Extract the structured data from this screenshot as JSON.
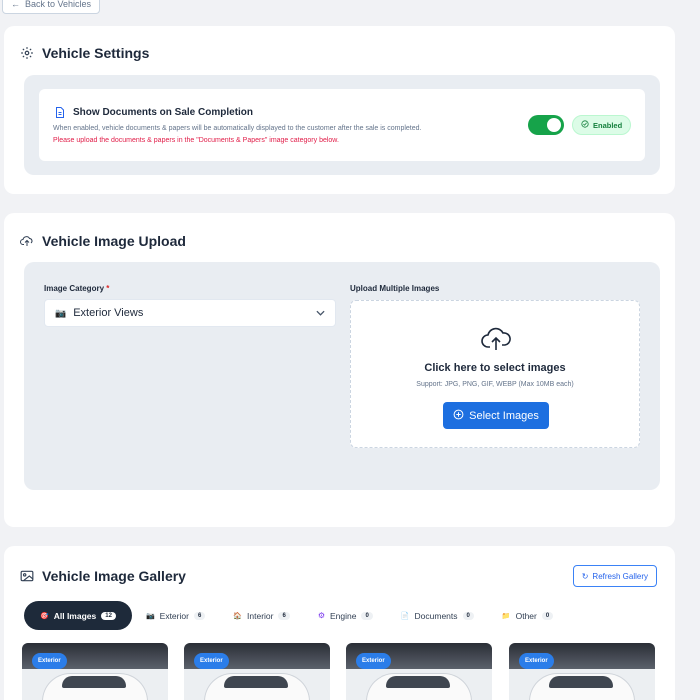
{
  "back_label": "Back to Vehicles",
  "settings": {
    "title": "Vehicle Settings",
    "doc_title": "Show Documents on Sale Completion",
    "doc_desc": "When enabled, vehicle documents & papers will be automatically displayed to the customer after the sale is completed.",
    "doc_warn": "Please upload the documents & papers in the \"Documents & Papers\" image category below.",
    "toggle_on": true,
    "enabled_label": "Enabled"
  },
  "upload": {
    "title": "Vehicle Image Upload",
    "category_label": "Image Category",
    "required_mark": "*",
    "category_value": "Exterior Views",
    "upload_label": "Upload Multiple Images",
    "dropzone_title": "Click here to select images",
    "dropzone_sub": "Support: JPG, PNG, GIF, WEBP (Max 10MB each)",
    "select_button": "Select Images"
  },
  "gallery": {
    "title": "Vehicle Image Gallery",
    "refresh_label": "Refresh Gallery",
    "tabs": [
      {
        "label": "All Images",
        "count": "12",
        "icon": "🎯"
      },
      {
        "label": "Exterior",
        "count": "6",
        "icon": "📷"
      },
      {
        "label": "Interior",
        "count": "6",
        "icon": "🏠"
      },
      {
        "label": "Engine",
        "count": "0",
        "icon": "⚙"
      },
      {
        "label": "Documents",
        "count": "0",
        "icon": "📄"
      },
      {
        "label": "Other",
        "count": "0",
        "icon": "📁"
      }
    ],
    "thumbs": [
      {
        "badge": "Exterior"
      },
      {
        "badge": "Exterior"
      },
      {
        "badge": "Exterior"
      },
      {
        "badge": "Exterior"
      }
    ]
  },
  "colors": {
    "primary": "#1d6fe0",
    "toggle_on": "#16a34a",
    "warning": "#e11d48",
    "active_tab": "#1e2a3a"
  }
}
